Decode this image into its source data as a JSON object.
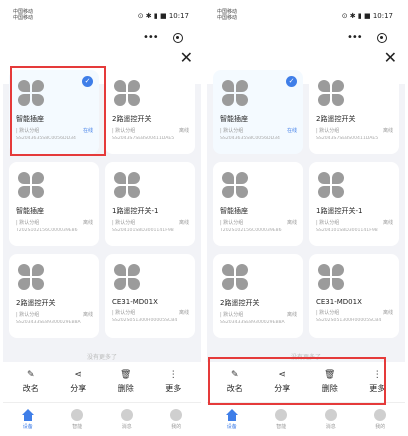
{
  "status": {
    "carrier1": "中国移动",
    "carrier2": "中国移动",
    "indicators": "⊙ ✱ ▮ ■",
    "time": "10:17"
  },
  "header": {
    "close_symbol": "✕",
    "more_symbol": "•••"
  },
  "devices": [
    {
      "name": "智能插座",
      "group": "| 默认分组",
      "status": "在线",
      "id": "SS2043635S8C0056DD34",
      "selected": true
    },
    {
      "name": "2路遥控开关",
      "group": "| 默认分组",
      "status": "离线",
      "id": "SS2043S7SEBS00411DAE5",
      "selected": false
    },
    {
      "name": "智能插座",
      "group": "| 默认分组",
      "status": "离线",
      "id": "T202S102156C000039E86",
      "selected": false
    },
    {
      "name": "1路遥控开关-1",
      "group": "| 默认分组",
      "status": "离线",
      "id": "SS204101S8D3001141F98",
      "selected": false
    },
    {
      "name": "2路遥控开关",
      "group": "| 默认分组",
      "status": "离线",
      "id": "SS203433SE89300029EB8A",
      "selected": false
    },
    {
      "name": "CE31-MD01X",
      "group": "| 默认分组",
      "status": "离线",
      "id": "SS202S051300H00005SCB4",
      "selected": false
    }
  ],
  "no_more": "没有更多了",
  "actions": [
    {
      "label": "改名",
      "icon": "✎",
      "icon_name": "edit-icon"
    },
    {
      "label": "分享",
      "icon": "⋖",
      "icon_name": "share-icon"
    },
    {
      "label": "删除",
      "icon": "🗑",
      "icon_name": "trash-icon"
    },
    {
      "label": "更多",
      "icon": "⋮",
      "icon_name": "more-vertical-icon"
    }
  ],
  "tabs": [
    {
      "label": "设备",
      "active": true
    },
    {
      "label": "智能",
      "active": false
    },
    {
      "label": "消息",
      "active": false
    },
    {
      "label": "我的",
      "active": false
    }
  ],
  "colors": {
    "accent": "#3f7ee8",
    "highlight": "#e53a3a",
    "background": "#f2f3f7"
  }
}
